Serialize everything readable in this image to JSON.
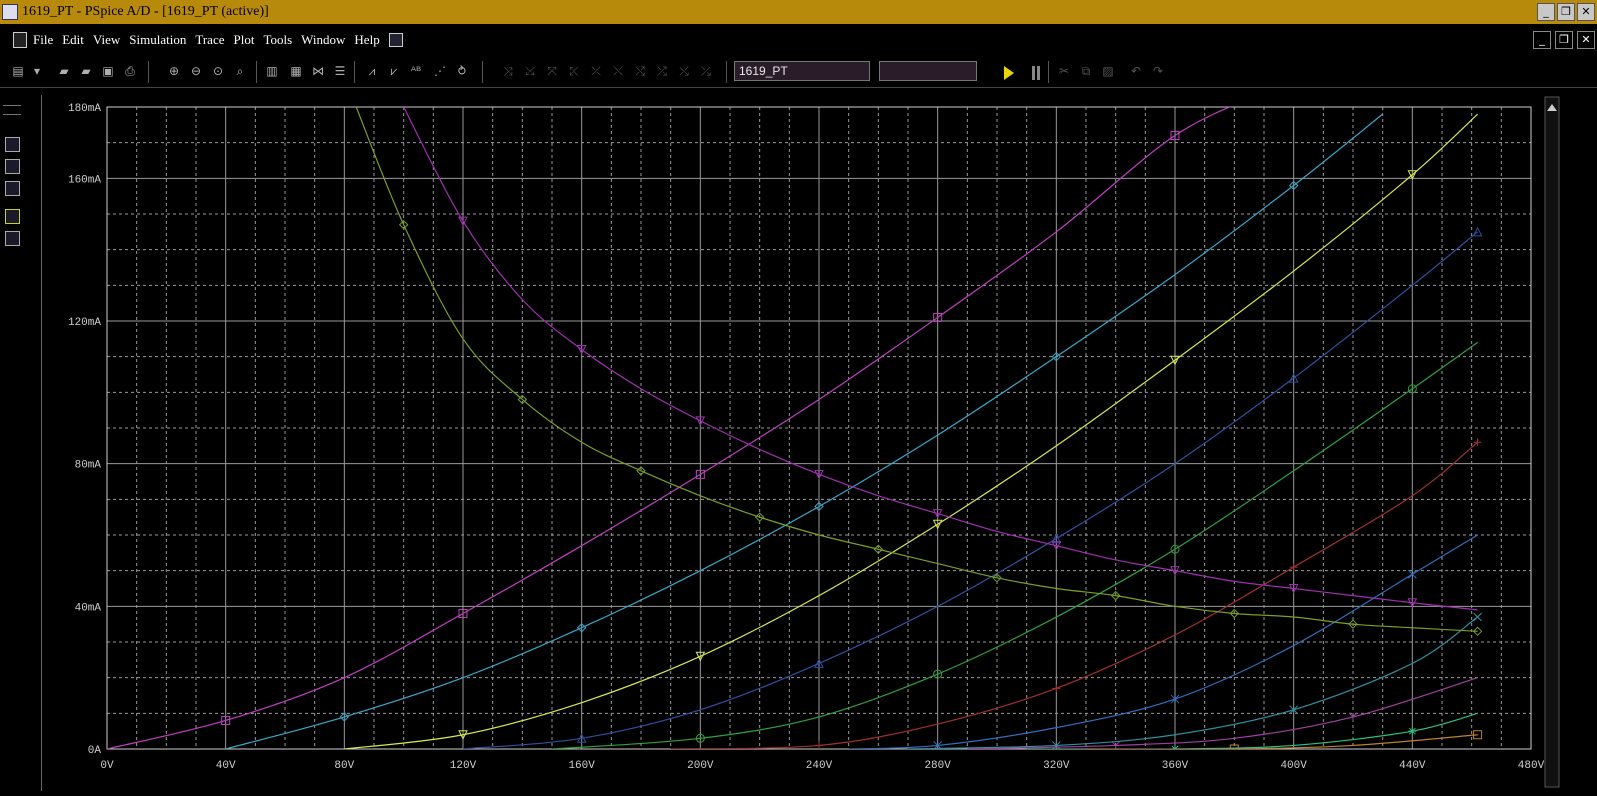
{
  "window": {
    "title": "1619_PT - PSpice A/D  - [1619_PT (active)]",
    "minimize_glyph": "_",
    "restore_glyph": "❐",
    "close_glyph": "✕"
  },
  "menu": {
    "items": [
      "File",
      "Edit",
      "View",
      "Simulation",
      "Trace",
      "Plot",
      "Tools",
      "Window",
      "Help"
    ]
  },
  "toolbar": {
    "profile_value": "1619_PT",
    "simulation_box_value": "",
    "icons": [
      "new-icon",
      "dropdown-arrow-icon",
      "open-icon",
      "open-file-icon",
      "save-icon",
      "print-icon",
      "zoom-in-icon",
      "zoom-out-icon",
      "zoom-area-icon",
      "zoom-fit-icon",
      "axis-settings-icon",
      "fourier-icon",
      "toggle-cursor-icon",
      "table-icon",
      "add-trace-icon",
      "add-plot-icon",
      "mark-label-icon",
      "mark-data-icon",
      "eval-goal-icon",
      "run-icon",
      "pause-icon",
      "cut-icon",
      "copy-icon",
      "paste-icon",
      "undo-icon",
      "redo-icon"
    ]
  },
  "colors": {
    "background": "#000000",
    "grid": "#9a9a9a",
    "axis_text": "#cfcfcf",
    "titlebar": "#b88a0c"
  },
  "chart_data": {
    "type": "line",
    "title": "",
    "xlabel": "",
    "ylabel": "",
    "xlim": [
      0,
      480
    ],
    "ylim": [
      0,
      180
    ],
    "x_unit": "V",
    "y_unit": "mA",
    "x_ticks": [
      "0V",
      "40V",
      "80V",
      "120V",
      "160V",
      "200V",
      "240V",
      "280V",
      "320V",
      "360V",
      "400V",
      "440V",
      "480V"
    ],
    "y_ticks": [
      "0A",
      "40mA",
      "80mA",
      "120mA",
      "160mA",
      "180mA"
    ],
    "grid": true,
    "series": [
      {
        "color": "#c040c0",
        "marker": "square",
        "x": [
          0,
          40,
          80,
          120,
          160,
          200,
          240,
          280,
          320,
          360,
          390
        ],
        "y": [
          0,
          8,
          20,
          38,
          57,
          77,
          98,
          121,
          145,
          172,
          184
        ]
      },
      {
        "color": "#3aa8c8",
        "marker": "diamond",
        "x": [
          40,
          80,
          120,
          160,
          200,
          240,
          280,
          320,
          360,
          400,
          430
        ],
        "y": [
          0,
          9,
          20,
          34,
          50,
          68,
          88,
          110,
          133,
          158,
          178
        ]
      },
      {
        "color": "#d8e850",
        "marker": "triangle-down",
        "x": [
          80,
          120,
          160,
          200,
          240,
          280,
          320,
          360,
          400,
          440,
          462
        ],
        "y": [
          0,
          4,
          13,
          26,
          43,
          63,
          85,
          109,
          134,
          161,
          178
        ]
      },
      {
        "color": "#3050a0",
        "marker": "triangle-up",
        "x": [
          120,
          160,
          200,
          240,
          280,
          320,
          360,
          400,
          440,
          462
        ],
        "y": [
          0,
          3,
          11,
          24,
          40,
          59,
          80,
          104,
          130,
          145
        ]
      },
      {
        "color": "#30a040",
        "marker": "circle",
        "x": [
          150,
          200,
          240,
          280,
          320,
          360,
          400,
          440,
          462
        ],
        "y": [
          0,
          3,
          9,
          21,
          37,
          56,
          78,
          101,
          114
        ]
      },
      {
        "color": "#a03030",
        "marker": "plus",
        "x": [
          190,
          240,
          280,
          320,
          360,
          400,
          440,
          462
        ],
        "y": [
          0,
          1,
          7,
          17,
          32,
          51,
          71,
          86
        ]
      },
      {
        "color": "#3070c0",
        "marker": "x",
        "x": [
          250,
          280,
          320,
          360,
          400,
          440,
          462
        ],
        "y": [
          0,
          1,
          6,
          14,
          29,
          49,
          60
        ]
      },
      {
        "color": "#3090a0",
        "marker": "x",
        "x": [
          270,
          320,
          360,
          400,
          440,
          462
        ],
        "y": [
          0,
          1,
          4,
          11,
          24,
          37
        ]
      },
      {
        "color": "#a040a0",
        "marker": "y",
        "x": [
          290,
          340,
          380,
          420,
          462
        ],
        "y": [
          0,
          1,
          3,
          9,
          20
        ]
      },
      {
        "color": "#30c080",
        "marker": "star",
        "x": [
          310,
          360,
          400,
          440,
          462
        ],
        "y": [
          0,
          0,
          1,
          5,
          10
        ]
      },
      {
        "color": "#c08030",
        "marker": "square",
        "x": [
          330,
          380,
          420,
          462
        ],
        "y": [
          0,
          0,
          1,
          4
        ]
      },
      {
        "color": "#78a028",
        "marker": "diamond",
        "x": [
          84,
          100,
          120,
          140,
          160,
          180,
          200,
          220,
          240,
          260,
          280,
          300,
          320,
          340,
          360,
          380,
          400,
          420,
          440,
          462
        ],
        "y": [
          180,
          147,
          115,
          98,
          86,
          78,
          71,
          65,
          60,
          56,
          52,
          48,
          45,
          43,
          40,
          38,
          37,
          35,
          34,
          33
        ]
      },
      {
        "color": "#a030b0",
        "marker": "triangle-down",
        "x": [
          100,
          120,
          140,
          160,
          180,
          200,
          220,
          240,
          260,
          280,
          300,
          320,
          340,
          360,
          380,
          400,
          420,
          440,
          462
        ],
        "y": [
          180,
          148,
          126,
          112,
          101,
          92,
          84,
          77,
          71,
          66,
          61,
          57,
          53,
          50,
          47,
          45,
          43,
          41,
          39
        ]
      }
    ]
  }
}
